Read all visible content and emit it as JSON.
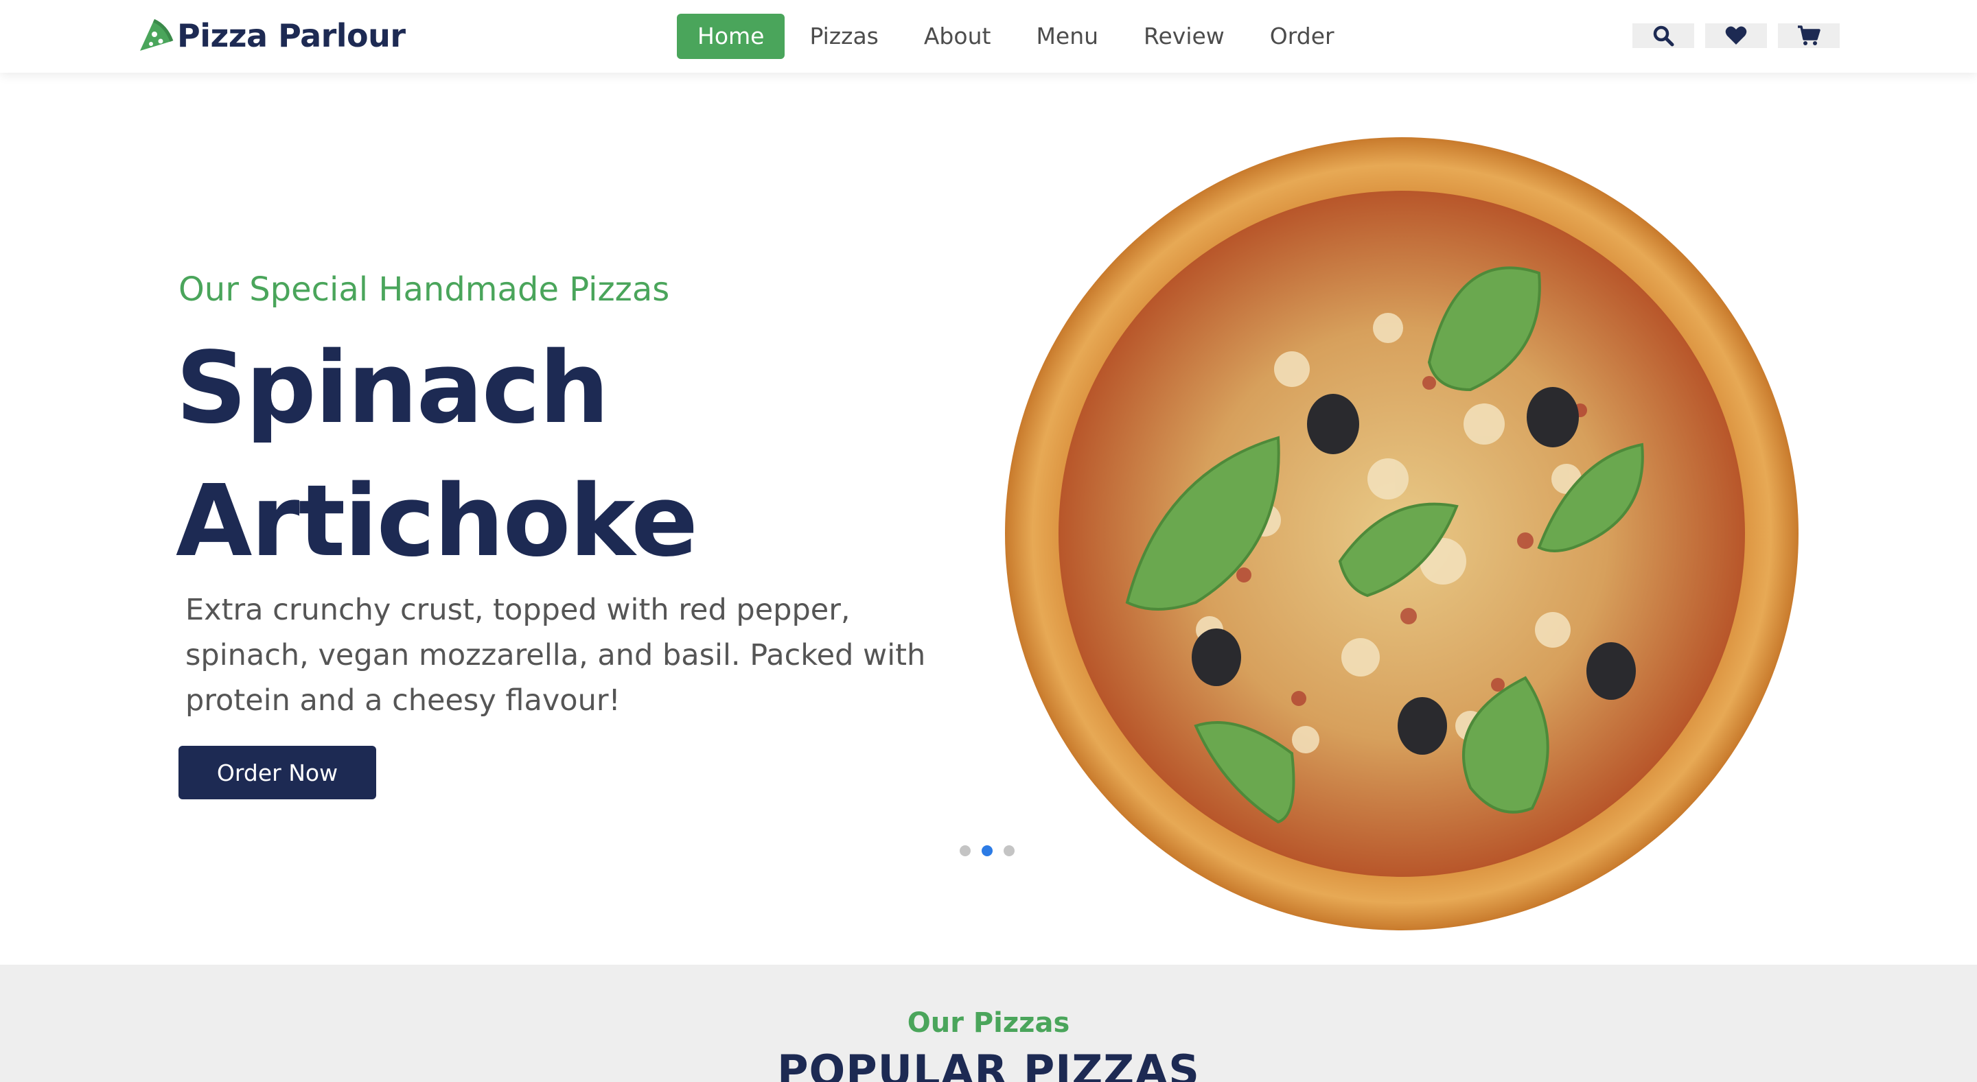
{
  "header": {
    "brand": "Pizza Parlour",
    "nav": [
      {
        "label": "Home",
        "active": true
      },
      {
        "label": "Pizzas",
        "active": false
      },
      {
        "label": "About",
        "active": false
      },
      {
        "label": "Menu",
        "active": false
      },
      {
        "label": "Review",
        "active": false
      },
      {
        "label": "Order",
        "active": false
      }
    ],
    "icons": [
      "search-icon",
      "heart-icon",
      "cart-icon"
    ]
  },
  "hero": {
    "subtitle": "Our Special Handmade Pizzas",
    "title_line1": "Spinach",
    "title_line2": "Artichoke",
    "description": "Extra crunchy crust, topped with red pepper, spinach, vegan mozzarella, and basil. Packed with protein and a cheesy flavour!",
    "button": "Order Now",
    "slides_total": 3,
    "slide_active": 2
  },
  "popular": {
    "subtitle": "Our Pizzas",
    "title": "POPULAR PIZZAS"
  },
  "colors": {
    "accent_green": "#4aa55b",
    "navy": "#1d2a53",
    "dot_active": "#2c7be5"
  }
}
